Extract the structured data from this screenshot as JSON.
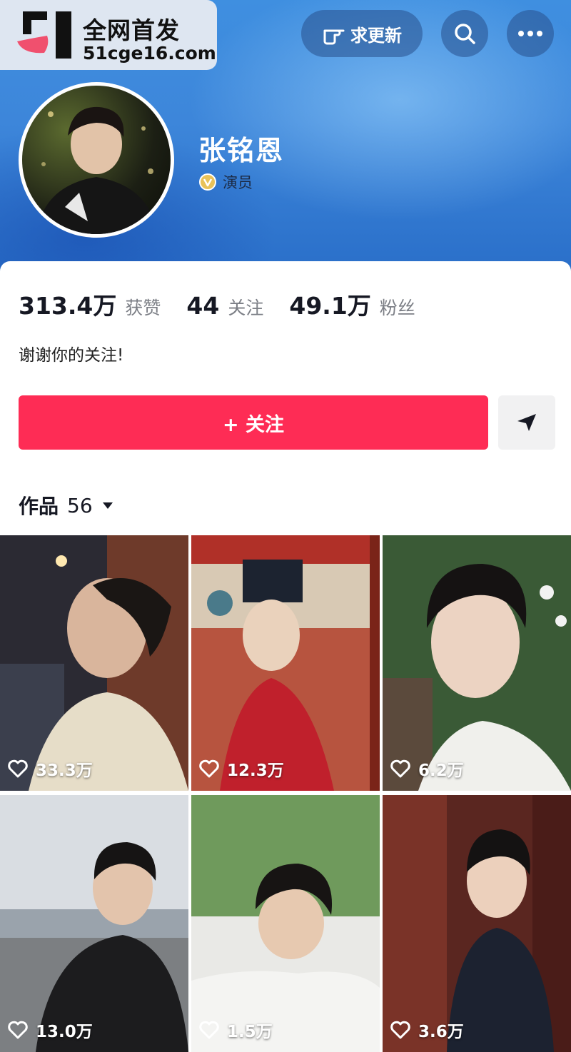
{
  "watermark": {
    "title": "全网首发",
    "url": "51cge16.com"
  },
  "header": {
    "request_update_label": "求更新",
    "search_icon": "search-icon",
    "more_icon": "more-icon"
  },
  "profile": {
    "name": "张铭恩",
    "role": "演员",
    "bio": "谢谢你的关注!"
  },
  "stats": [
    {
      "value": "313.4万",
      "label": "获赞"
    },
    {
      "value": "44",
      "label": "关注"
    },
    {
      "value": "49.1万",
      "label": "粉丝"
    }
  ],
  "actions": {
    "follow_label": "+ 关注",
    "share_icon": "send-icon"
  },
  "works": {
    "label": "作品",
    "count": "56"
  },
  "videos": [
    {
      "likes": "33.3万"
    },
    {
      "likes": "12.3万"
    },
    {
      "likes": "6.2万"
    },
    {
      "likes": "13.0万"
    },
    {
      "likes": "1.5万"
    },
    {
      "likes": "3.6万"
    }
  ],
  "colors": {
    "accent": "#fe2c55",
    "banner": "#3d86da"
  }
}
